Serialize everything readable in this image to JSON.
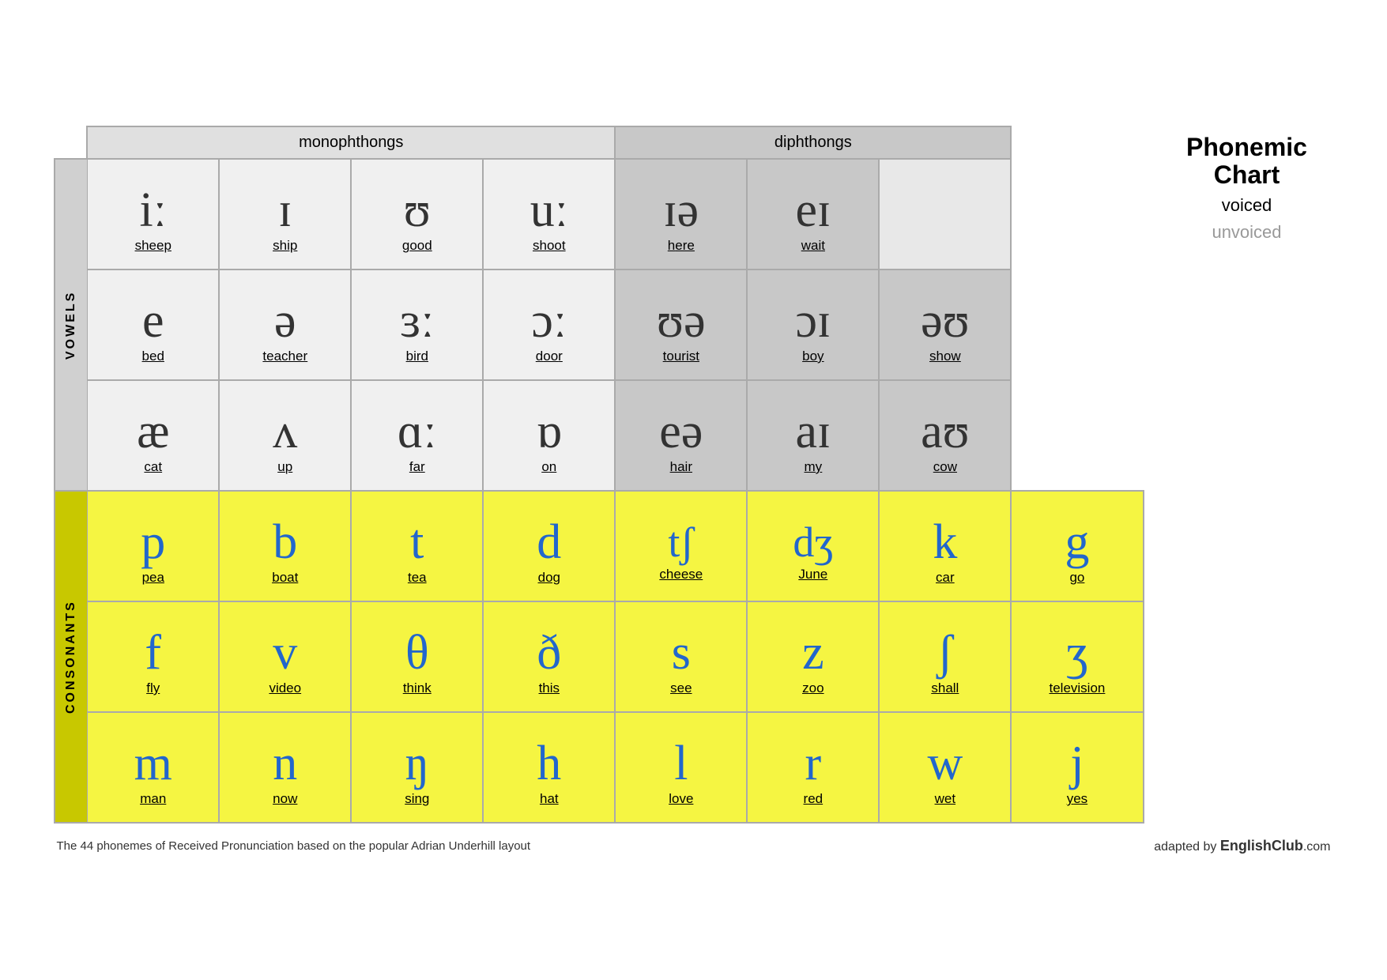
{
  "title": {
    "main": "Phonemic\nChart",
    "voiced": "voiced",
    "unvoiced": "unvoiced"
  },
  "sections": {
    "monophthongs": "monophthongs",
    "diphthongs": "diphthongs",
    "vowels": "VOWELS",
    "consonants": "CONSONANTS"
  },
  "vowel_rows": [
    {
      "cells": [
        {
          "symbol": "iː",
          "word": "sheep",
          "ul": "sh"
        },
        {
          "symbol": "ɪ",
          "word": "ship",
          "ul": "sh"
        },
        {
          "symbol": "ʊ",
          "word": "good",
          "ul": "oo"
        },
        {
          "symbol": "uː",
          "word": "shoot",
          "ul": "oo"
        },
        {
          "symbol": "ɪə",
          "word": "here",
          "ul": "ere",
          "diphthong": true
        },
        {
          "symbol": "eɪ",
          "word": "wait",
          "ul": "ai",
          "diphthong": true
        }
      ]
    },
    {
      "cells": [
        {
          "symbol": "e",
          "word": "bed",
          "ul": "e"
        },
        {
          "symbol": "ə",
          "word": "teacher",
          "ul": "er"
        },
        {
          "symbol": "ɜː",
          "word": "bird",
          "ul": "ir"
        },
        {
          "symbol": "ɔː",
          "word": "door",
          "ul": "oo"
        },
        {
          "symbol": "ʊə",
          "word": "tourist",
          "ul": "our",
          "diphthong": true
        },
        {
          "symbol": "ɔɪ",
          "word": "boy",
          "ul": "oy",
          "diphthong": true
        },
        {
          "symbol": "əʊ",
          "word": "show",
          "ul": "ow",
          "diphthong": true
        }
      ]
    },
    {
      "cells": [
        {
          "symbol": "æ",
          "word": "cat",
          "ul": "a"
        },
        {
          "symbol": "ʌ",
          "word": "up",
          "ul": "u"
        },
        {
          "symbol": "ɑː",
          "word": "far",
          "ul": "a"
        },
        {
          "symbol": "ɒ",
          "word": "on",
          "ul": "o"
        },
        {
          "symbol": "eə",
          "word": "hair",
          "ul": "air",
          "diphthong": true
        },
        {
          "symbol": "aɪ",
          "word": "my",
          "ul": "y",
          "diphthong": true
        },
        {
          "symbol": "aʊ",
          "word": "cow",
          "ul": "ow",
          "diphthong": true
        }
      ]
    }
  ],
  "consonant_rows": [
    {
      "cells": [
        {
          "symbol": "p",
          "word": "pea",
          "ul": "p"
        },
        {
          "symbol": "b",
          "word": "boat",
          "ul": "b"
        },
        {
          "symbol": "t",
          "word": "tea",
          "ul": "t"
        },
        {
          "symbol": "d",
          "word": "dog",
          "ul": "d"
        },
        {
          "symbol": "tʃ",
          "word": "cheese",
          "ul": "ch"
        },
        {
          "symbol": "dʒ",
          "word": "June",
          "ul": "J"
        },
        {
          "symbol": "k",
          "word": "car",
          "ul": "c"
        },
        {
          "symbol": "g",
          "word": "go",
          "ul": "g"
        }
      ]
    },
    {
      "cells": [
        {
          "symbol": "f",
          "word": "fly",
          "ul": "f"
        },
        {
          "symbol": "v",
          "word": "video",
          "ul": "v"
        },
        {
          "symbol": "θ",
          "word": "think",
          "ul": "th"
        },
        {
          "symbol": "ð",
          "word": "this",
          "ul": "th"
        },
        {
          "symbol": "s",
          "word": "see",
          "ul": "s"
        },
        {
          "symbol": "z",
          "word": "zoo",
          "ul": "z"
        },
        {
          "symbol": "ʃ",
          "word": "shall",
          "ul": "sh"
        },
        {
          "symbol": "ʒ",
          "word": "television",
          "ul": "si"
        }
      ]
    },
    {
      "cells": [
        {
          "symbol": "m",
          "word": "man",
          "ul": "m"
        },
        {
          "symbol": "n",
          "word": "now",
          "ul": "n"
        },
        {
          "symbol": "ŋ",
          "word": "sing",
          "ul": "ng"
        },
        {
          "symbol": "h",
          "word": "hat",
          "ul": "h"
        },
        {
          "symbol": "l",
          "word": "love",
          "ul": "l"
        },
        {
          "symbol": "r",
          "word": "red",
          "ul": "r"
        },
        {
          "symbol": "w",
          "word": "wet",
          "ul": "w"
        },
        {
          "symbol": "j",
          "word": "yes",
          "ul": "y"
        }
      ]
    }
  ],
  "footer": {
    "note": "The 44 phonemes of Received Pronunciation based on the popular Adrian Underhill layout",
    "adapted": "adapted by",
    "brand": "EnglishClub.com"
  }
}
